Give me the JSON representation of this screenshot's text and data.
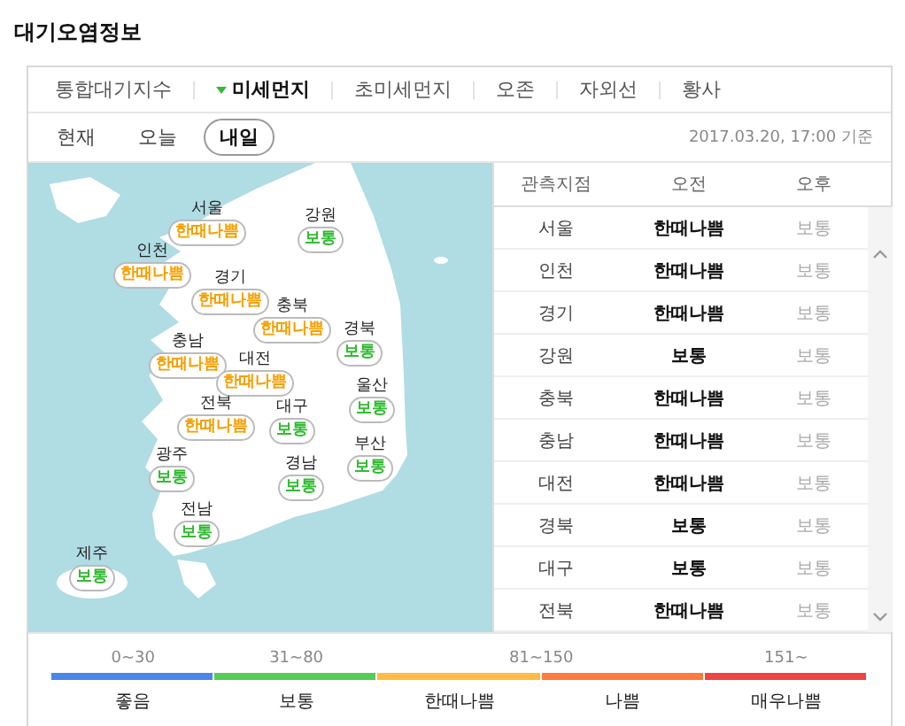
{
  "title": "대기오염정보",
  "tabs": [
    {
      "label": "통합대기지수",
      "selected": false
    },
    {
      "label": "미세먼지",
      "selected": true
    },
    {
      "label": "초미세먼지",
      "selected": false
    },
    {
      "label": "오존",
      "selected": false
    },
    {
      "label": "자외선",
      "selected": false
    },
    {
      "label": "황사",
      "selected": false
    }
  ],
  "day_tabs": [
    {
      "label": "현재",
      "selected": false
    },
    {
      "label": "오늘",
      "selected": false
    },
    {
      "label": "내일",
      "selected": true
    }
  ],
  "timestamp": "2017.03.20, 17:00 기준",
  "map_regions": [
    {
      "name": "서울",
      "grade": "한때나쁨",
      "color": "#f5a000"
    },
    {
      "name": "강원",
      "grade": "보통",
      "color": "#33bb33"
    },
    {
      "name": "인천",
      "grade": "한때나쁨",
      "color": "#f5a000"
    },
    {
      "name": "경기",
      "grade": "한때나쁨",
      "color": "#f5a000"
    },
    {
      "name": "충북",
      "grade": "한때나쁨",
      "color": "#f5a000"
    },
    {
      "name": "경북",
      "grade": "보통",
      "color": "#33bb33"
    },
    {
      "name": "충남",
      "grade": "한때나쁨",
      "color": "#f5a000"
    },
    {
      "name": "대전",
      "grade": "한때나쁨",
      "color": "#f5a000"
    },
    {
      "name": "울산",
      "grade": "보통",
      "color": "#33bb33"
    },
    {
      "name": "전북",
      "grade": "한때나쁨",
      "color": "#f5a000"
    },
    {
      "name": "대구",
      "grade": "보통",
      "color": "#33bb33"
    },
    {
      "name": "광주",
      "grade": "보통",
      "color": "#33bb33"
    },
    {
      "name": "부산",
      "grade": "보통",
      "color": "#33bb33"
    },
    {
      "name": "경남",
      "grade": "보통",
      "color": "#33bb33"
    },
    {
      "name": "전남",
      "grade": "보통",
      "color": "#33bb33"
    },
    {
      "name": "제주",
      "grade": "보통",
      "color": "#33bb33"
    }
  ],
  "table": {
    "columns": [
      "관측지점",
      "오전",
      "오후"
    ],
    "rows": [
      [
        "서울",
        "한때나쁨",
        "보통"
      ],
      [
        "인천",
        "한때나쁨",
        "보통"
      ],
      [
        "경기",
        "한때나쁨",
        "보통"
      ],
      [
        "강원",
        "보통",
        "보통"
      ],
      [
        "충북",
        "한때나쁨",
        "보통"
      ],
      [
        "충남",
        "한때나쁨",
        "보통"
      ],
      [
        "대전",
        "한때나쁨",
        "보통"
      ],
      [
        "경북",
        "보통",
        "보통"
      ],
      [
        "대구",
        "보통",
        "보통"
      ],
      [
        "전북",
        "한때나쁨",
        "보통"
      ]
    ]
  },
  "legend": [
    {
      "range": "0~30",
      "grades": [
        {
          "label": "좋음",
          "color": "#4a86e8"
        }
      ]
    },
    {
      "range": "31~80",
      "grades": [
        {
          "label": "보통",
          "color": "#55cc55"
        }
      ]
    },
    {
      "range": "81~150",
      "grades": [
        {
          "label": "한때나쁨",
          "color": "#ffbb44"
        },
        {
          "label": "나쁨",
          "color": "#ff7a3d"
        }
      ]
    },
    {
      "range": "151~",
      "grades": [
        {
          "label": "매우나쁨",
          "color": "#ee4444"
        }
      ]
    }
  ]
}
